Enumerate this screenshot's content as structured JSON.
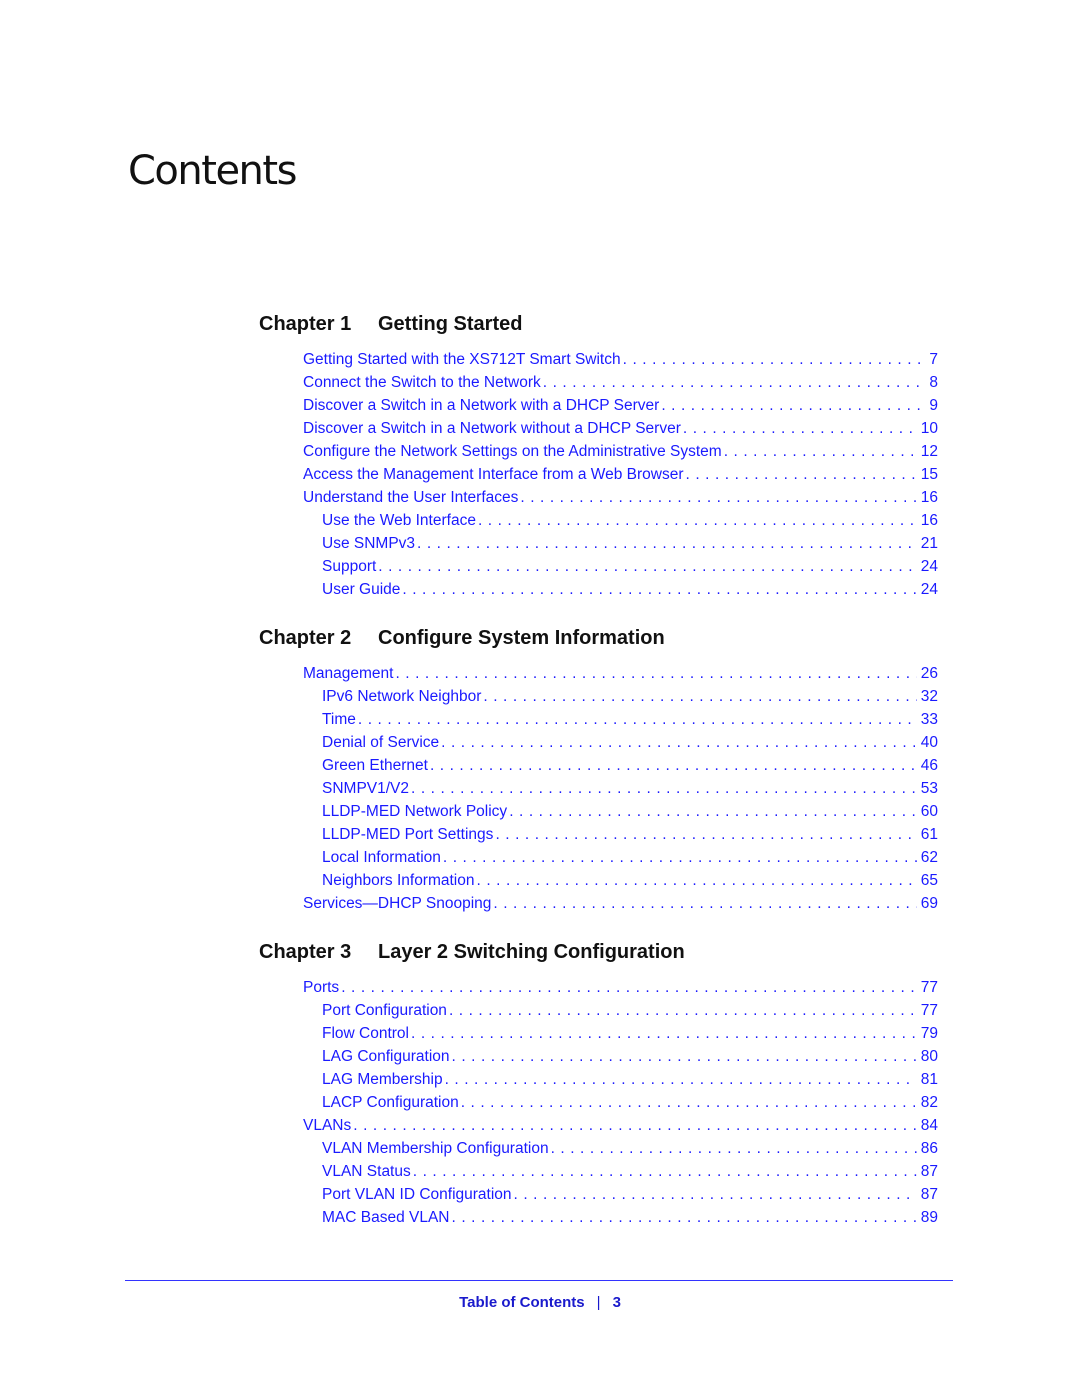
{
  "page": {
    "title": "Contents"
  },
  "chapters": [
    {
      "number": "Chapter 1",
      "title": "Getting Started",
      "entries": [
        {
          "label": "Getting Started with the XS712T Smart Switch",
          "page": "7",
          "level": 1
        },
        {
          "label": "Connect the Switch to the Network",
          "page": "8",
          "level": 1
        },
        {
          "label": "Discover a Switch in a Network with a DHCP Server",
          "page": "9",
          "level": 1
        },
        {
          "label": "Discover a Switch in a Network without a DHCP Server",
          "page": "10",
          "level": 1
        },
        {
          "label": "Configure the Network Settings on the Administrative System",
          "page": "12",
          "level": 1
        },
        {
          "label": "Access the Management Interface from a Web Browser",
          "page": "15",
          "level": 1
        },
        {
          "label": "Understand the User Interfaces",
          "page": "16",
          "level": 1
        },
        {
          "label": "Use the Web Interface",
          "page": "16",
          "level": 2
        },
        {
          "label": "Use SNMPv3",
          "page": "21",
          "level": 2
        },
        {
          "label": "Support",
          "page": "24",
          "level": 2
        },
        {
          "label": "User Guide",
          "page": "24",
          "level": 2
        }
      ]
    },
    {
      "number": "Chapter 2",
      "title": "Configure System Information",
      "entries": [
        {
          "label": "Management",
          "page": "26",
          "level": 1
        },
        {
          "label": "IPv6 Network Neighbor",
          "page": "32",
          "level": 2
        },
        {
          "label": "Time",
          "page": "33",
          "level": 2
        },
        {
          "label": "Denial of Service",
          "page": "40",
          "level": 2
        },
        {
          "label": "Green Ethernet",
          "page": "46",
          "level": 2
        },
        {
          "label": "SNMPV1/V2",
          "page": "53",
          "level": 2
        },
        {
          "label": "LLDP-MED Network Policy",
          "page": "60",
          "level": 2
        },
        {
          "label": "LLDP-MED Port Settings",
          "page": "61",
          "level": 2
        },
        {
          "label": "Local Information",
          "page": "62",
          "level": 2
        },
        {
          "label": "Neighbors Information",
          "page": "65",
          "level": 2
        },
        {
          "label": "Services—DHCP Snooping",
          "page": "69",
          "level": 1
        }
      ]
    },
    {
      "number": "Chapter 3",
      "title": "Layer 2 Switching Configuration",
      "entries": [
        {
          "label": "Ports",
          "page": "77",
          "level": 1
        },
        {
          "label": "Port Configuration",
          "page": "77",
          "level": 2
        },
        {
          "label": "Flow Control",
          "page": "79",
          "level": 2
        },
        {
          "label": "LAG Configuration",
          "page": "80",
          "level": 2
        },
        {
          "label": "LAG Membership",
          "page": "81",
          "level": 2
        },
        {
          "label": "LACP Configuration",
          "page": "82",
          "level": 2
        },
        {
          "label": "VLANs",
          "page": "84",
          "level": 1
        },
        {
          "label": "VLAN Membership Configuration",
          "page": "86",
          "level": 2
        },
        {
          "label": "VLAN Status",
          "page": "87",
          "level": 2
        },
        {
          "label": "Port VLAN ID Configuration",
          "page": "87",
          "level": 2
        },
        {
          "label": "MAC Based VLAN",
          "page": "89",
          "level": 2
        }
      ]
    }
  ],
  "footer": {
    "section": "Table of Contents",
    "separator": "|",
    "page_number": "3"
  },
  "colors": {
    "link": "#1a1aff",
    "heading": "#111111",
    "rule": "#3333ff"
  }
}
